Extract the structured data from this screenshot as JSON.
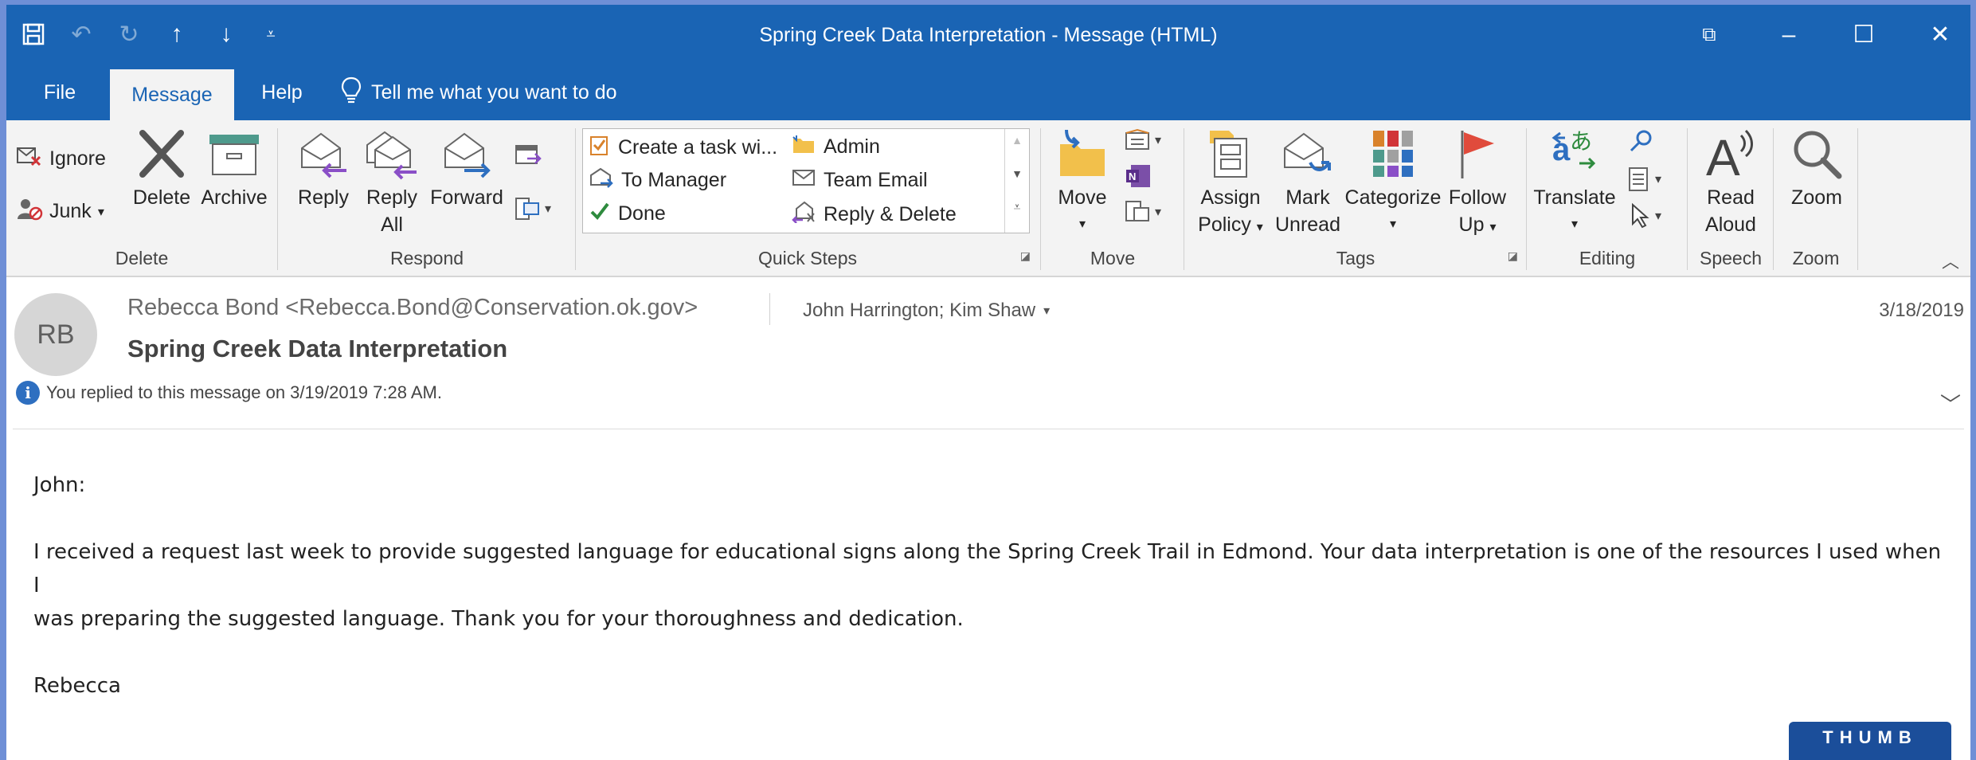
{
  "window": {
    "title": "Spring Creek Data Interpretation  -  Message (HTML)"
  },
  "menu": {
    "file": "File",
    "message": "Message",
    "help": "Help",
    "tell_me": "Tell me what you want to do"
  },
  "ribbon": {
    "delete_group": {
      "label": "Delete",
      "ignore": "Ignore",
      "junk": "Junk",
      "delete": "Delete",
      "archive": "Archive"
    },
    "respond_group": {
      "label": "Respond",
      "reply": "Reply",
      "reply_all_1": "Reply",
      "reply_all_2": "All",
      "forward": "Forward"
    },
    "quick_steps": {
      "label": "Quick Steps",
      "items": [
        "Create a task wi...",
        "To Manager",
        "Done",
        "Admin",
        "Team Email",
        "Reply & Delete"
      ]
    },
    "move_group": {
      "label": "Move",
      "move": "Move"
    },
    "tags_group": {
      "label": "Tags",
      "assign_1": "Assign",
      "assign_2": "Policy",
      "mark_1": "Mark",
      "mark_2": "Unread",
      "categorize": "Categorize",
      "follow_1": "Follow",
      "follow_2": "Up"
    },
    "editing_group": {
      "label": "Editing",
      "translate": "Translate"
    },
    "speech_group": {
      "label": "Speech",
      "read_1": "Read",
      "read_2": "Aloud"
    },
    "zoom_group": {
      "label": "Zoom",
      "zoom": "Zoom"
    }
  },
  "message": {
    "avatar_initials": "RB",
    "sender": "Rebecca Bond <Rebecca.Bond@Conservation.ok.gov>",
    "recipients": "John Harrington; Kim Shaw",
    "date": "3/18/2019",
    "subject": "Spring Creek Data Interpretation",
    "replied_notice": "You replied to this message on 3/19/2019 7:28 AM.",
    "body": {
      "greeting": "John:",
      "para1_line1": "I received a request last week to provide suggested language for educational signs along the Spring Creek Trail in Edmond. Your data interpretation is one of the resources I used when I",
      "para1_line2": "was preparing the suggested language. Thank you for your thoroughness and dedication.",
      "signoff": "Rebecca"
    }
  },
  "watermark": "THUMB",
  "colors": {
    "title_bar": "#1a64b4",
    "ribbon_bg": "#f3f3f3",
    "accent_blue": "#2e6fc0",
    "accent_purple": "#8a4fc7",
    "flag_red": "#e04b3c"
  }
}
